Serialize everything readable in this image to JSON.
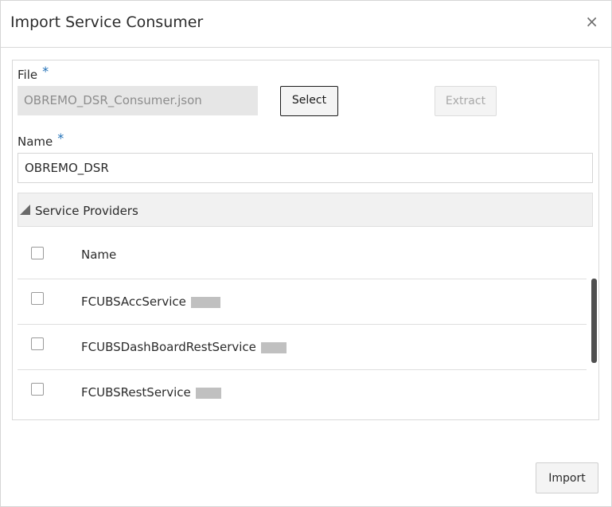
{
  "dialog": {
    "title": "Import Service Consumer",
    "close_glyph": "×"
  },
  "file": {
    "label": "File",
    "required_mark": "*",
    "value": "OBREMO_DSR_Consumer.json",
    "select_label": "Select",
    "extract_label": "Extract"
  },
  "name": {
    "label": "Name",
    "required_mark": "*",
    "value": "OBREMO_DSR"
  },
  "providers": {
    "section_title": "Service Providers",
    "column_name": "Name",
    "items": [
      {
        "name": "FCUBSAccService",
        "checked": false
      },
      {
        "name": "FCUBSDashBoardRestService",
        "checked": false
      },
      {
        "name": "FCUBSRestService",
        "checked": false
      }
    ]
  },
  "footer": {
    "import_label": "Import"
  },
  "colors": {
    "required": "#1f6fb6",
    "disabled_text": "#a8a8a8",
    "field_bg": "#e6e6e6"
  }
}
